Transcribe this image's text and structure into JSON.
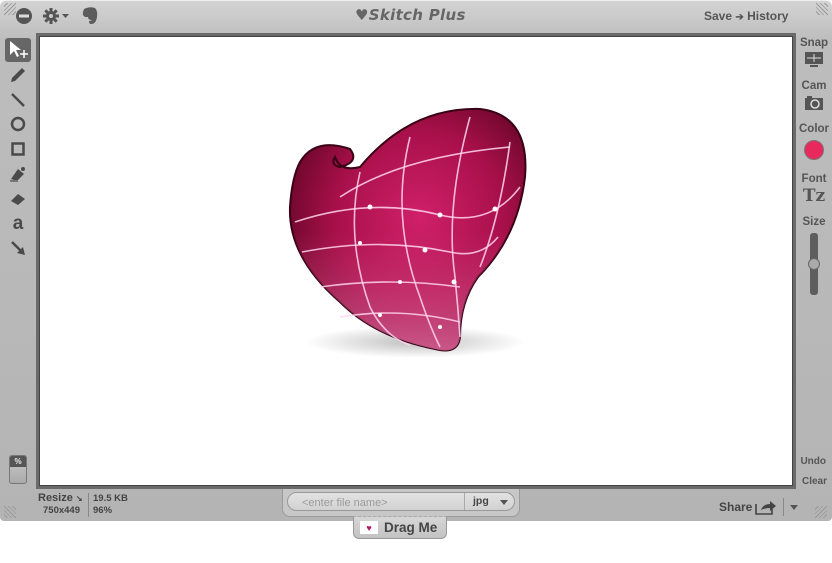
{
  "window": {
    "title": "♥Skitch Plus",
    "save_label": "Save",
    "arrow": "➔",
    "history_label": "History"
  },
  "toolbar_left_icons": [
    "minus-circle-icon",
    "gear-menu-icon",
    "evernote-elephant-icon"
  ],
  "tools": [
    {
      "name": "select-move-tool",
      "active": true
    },
    {
      "name": "pencil-tool",
      "active": false
    },
    {
      "name": "line-tool",
      "active": false
    },
    {
      "name": "ellipse-tool",
      "active": false
    },
    {
      "name": "rectangle-tool",
      "active": false
    },
    {
      "name": "fill-bucket-tool",
      "active": false
    },
    {
      "name": "eraser-tool",
      "active": false
    },
    {
      "name": "text-tool",
      "active": false
    },
    {
      "name": "arrow-tool",
      "active": false
    }
  ],
  "text_tool_glyph": "a",
  "right_panel": {
    "snap_label": "Snap",
    "cam_label": "Cam",
    "color_label": "Color",
    "color_value": "#e8295c",
    "font_label": "Font",
    "font_glyph": "Tz",
    "size_label": "Size",
    "size_level": 0.5,
    "undo_label": "Undo",
    "clear_label": "Clear"
  },
  "zoom_toggle_label": "%",
  "status": {
    "resize_label": "Resize",
    "dimensions": "750x449",
    "file_size": "19.5 KB",
    "zoom_percent": "96%"
  },
  "file": {
    "name_value": "",
    "name_placeholder": "<enter file name>",
    "format": "jpg"
  },
  "drag_label": "Drag Me",
  "share_label": "Share",
  "canvas_image": "skitch-heart-logo"
}
